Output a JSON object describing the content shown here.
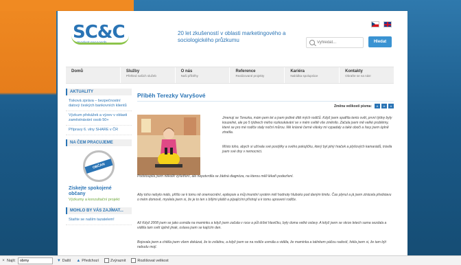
{
  "site": {
    "logo": "SC&C",
    "logo_sub": "market research",
    "tagline": "20 let zkušeností v oblasti marketingového a sociologického průzkumu"
  },
  "search": {
    "placeholder": "Vyhledat...",
    "button_label": "Hledat"
  },
  "nav": [
    {
      "title": "Domů",
      "subtitle": ""
    },
    {
      "title": "Služby",
      "subtitle": "Přehled našich služeb"
    },
    {
      "title": "O nás",
      "subtitle": "Naši příběhy"
    },
    {
      "title": "Reference",
      "subtitle": "Realizované projekty"
    },
    {
      "title": "Kariéra",
      "subtitle": "Nabídka spolupráce"
    },
    {
      "title": "Kontakty",
      "subtitle": "Obraťte se na nás!"
    }
  ],
  "sidebar": {
    "news_heading": "AKTUALITY",
    "news": [
      "Tisková zpráva – bezpečnostní datový českých bankovních klientů",
      "Výzkum překážek a výzev v oblasti zaměstnávání osob 50+",
      "Přípravy 6. vlny SHARE v ČR"
    ],
    "working_heading": "NA ČEM PRACUJEME",
    "badge_text": "OBČAN",
    "promo_title": "Získejte spokojené občany",
    "promo_sub": "Výzkumy a konzultační projekt",
    "interest_heading": "MOHLO BY VÁS ZAJÍMAT...",
    "interest_link": "Staňte se naším tazatelem!"
  },
  "article": {
    "title": "Příběh Terezky Varyšové",
    "font_size_label": "Změna velikosti písma:",
    "p1": "Jmenuji se Terezka, mám pem let a jsem jediné dítě mých rodičů. Když jsem spatřila tento svět, první týdny byly kouzelné, ale po 5 týdnech mého rozkoukávání se v mém světě vše změnilo. Začala jsem mě velké problémy, které se pro mé rodiče staly noční můrou. Mé krásné černé vlásky mi vypadaly a také oboči a řasy jsem úplně ztratila.",
    "p2": "Místo toho, abych si užívala své postýlky a svého pokojíčku, který byl plný hraček a plyšových kamarádů, trávila jsem své dny v nemocnici.",
    "p3": "Podstoupila jsem několik vyšetření, ale nepotvrdila se žádná diagnóza, na kterou měli lékaři podezření.",
    "p4": "Aby toho nebylo málo, přišlo se k tomu ně onemocnění, epilepsie a můj imunitní systém měl hodnoty hluboko pod daným limitu. Čas plynul a já jsem ztrácela představu o mém domově, myslela jsem si, že je to ten s bílými plášti a pípajícími přístroji a k tomu upravení rodiče.",
    "p5": "Až Když 2008 jsem se jako usmála na maminku a když jsem začala v roce a půl držet hlavičku, byly doma velké oslavy. A když jsem se skrze letech sama sezdala a viděla tam svět úplně jinak, oslava jsem se kajícím den.",
    "p6": "Bojovala jsem a chtěla jsem všem dokázat, že to zvládnu, a když jsem se na rodiče usmála a viděla, že maminka a tatínkem páčou radostí, řekla jsem si, že tam být nebudu mojí."
  },
  "findbar": {
    "close": "×",
    "label": "Najít:",
    "value": "obmy",
    "next": "Další",
    "prev": "Předchozí",
    "highlight": "Zvýraznit",
    "match_case": "Rozlišovat velikost"
  }
}
